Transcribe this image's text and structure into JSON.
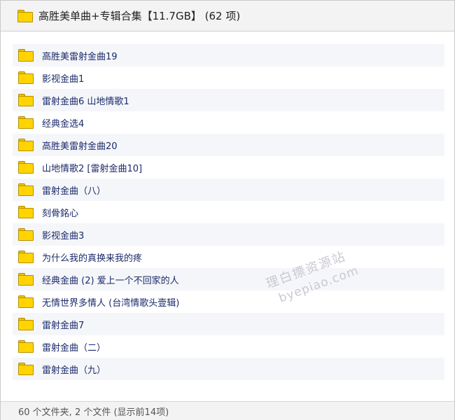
{
  "header": {
    "icon": "folder-icon",
    "title": "高胜美单曲+专辑合集【11.7GB】 (62 项)"
  },
  "items": [
    {
      "icon": "folder-icon",
      "label": "高胜美雷射金曲19"
    },
    {
      "icon": "folder-icon",
      "label": "影视金曲1"
    },
    {
      "icon": "folder-icon",
      "label": "雷射金曲6 山地情歌1"
    },
    {
      "icon": "folder-icon",
      "label": "经典金选4"
    },
    {
      "icon": "folder-icon",
      "label": "高胜美雷射金曲20"
    },
    {
      "icon": "folder-icon",
      "label": "山地情歌2 [雷射金曲10]"
    },
    {
      "icon": "folder-icon",
      "label": "雷射金曲（八）"
    },
    {
      "icon": "folder-icon",
      "label": "刻骨銘心"
    },
    {
      "icon": "folder-icon",
      "label": "影视金曲3"
    },
    {
      "icon": "folder-icon",
      "label": "为什么我的真换来我的疼"
    },
    {
      "icon": "folder-icon",
      "label": "经典金曲 (2) 爱上一个不回家的人"
    },
    {
      "icon": "folder-icon",
      "label": "无情世界多情人 (台湾情歌头壹辑)"
    },
    {
      "icon": "folder-icon",
      "label": "雷射金曲7"
    },
    {
      "icon": "folder-icon",
      "label": "雷射金曲（二）"
    },
    {
      "icon": "folder-icon",
      "label": "雷射金曲（九）"
    }
  ],
  "watermark": {
    "line1": "理白摽资源站",
    "line2": "byepiao.com"
  },
  "footer": {
    "status": "60 个文件夹, 2 个文件 (显示前14项)"
  },
  "colors": {
    "folder_fill": "#ffd400",
    "folder_border": "#b38f00",
    "text": "#1b2a6b",
    "row_alt": "#f5f6f9",
    "header_bg": "#f3f3f3"
  }
}
